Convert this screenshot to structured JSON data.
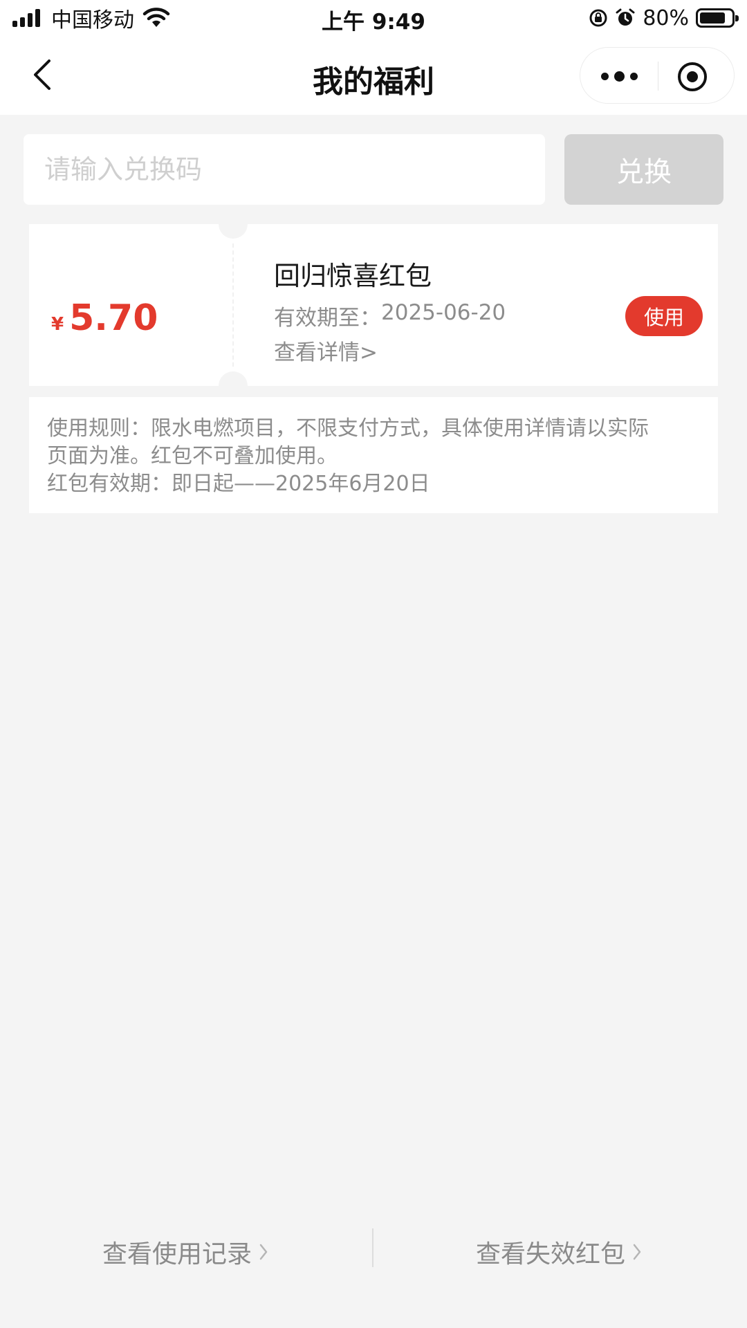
{
  "status_bar": {
    "carrier": "中国移动",
    "time": "上午 9:49",
    "battery_percent": "80%",
    "icons": [
      "signal-icon",
      "wifi-icon",
      "orientation-lock-icon",
      "alarm-icon",
      "battery-icon"
    ]
  },
  "nav": {
    "title": "我的福利",
    "back_icon": "chevron-left-icon",
    "more_icon": "more-dots-icon",
    "close_icon": "target-close-icon"
  },
  "redeem": {
    "placeholder": "请输入兑换码",
    "value": "",
    "button_label": "兑换"
  },
  "coupon": {
    "currency": "¥",
    "amount": "5.70",
    "title": "回归惊喜红包",
    "expiry_label": "有效期至：",
    "expiry_date": "2025-06-20",
    "details_link": "查看详情>",
    "use_button": "使用"
  },
  "rules": {
    "line1": "使用规则：限水电燃项目，不限支付方式，具体使用详情请以实际",
    "line2": "页面为准。红包不可叠加使用。",
    "line3": "红包有效期：即日起——2025年6月20日"
  },
  "bottom": {
    "usage_record": "查看使用记录",
    "expired_packets": "查看失效红包"
  },
  "colors": {
    "accent_red": "#e33a2d",
    "background": "#f4f4f4",
    "disabled_button": "#d3d3d3",
    "muted_text": "#8c8c8c"
  }
}
